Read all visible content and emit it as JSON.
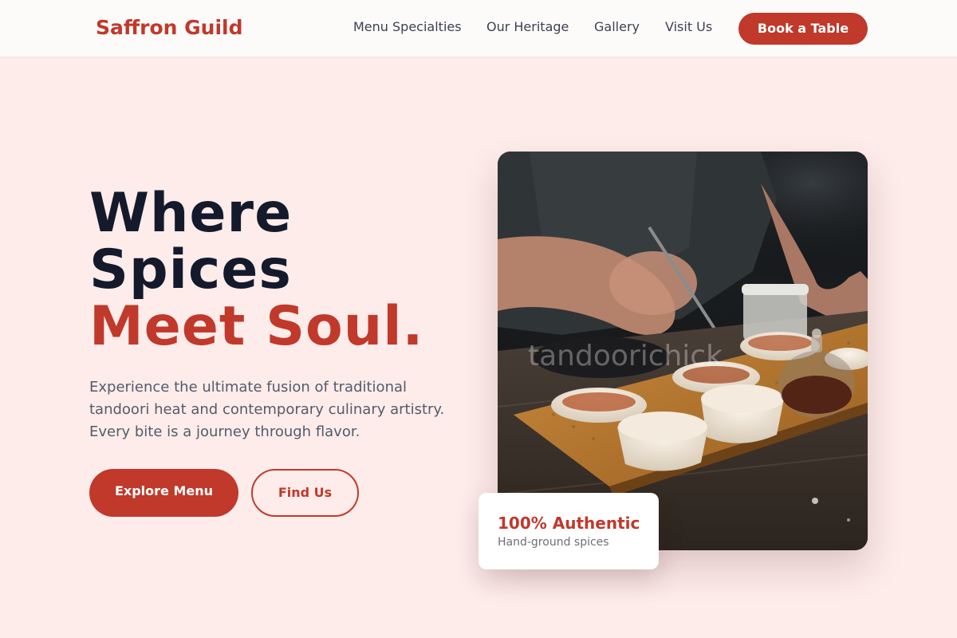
{
  "nav": {
    "brand": "Saffron Guild",
    "links": [
      "Menu Specialties",
      "Our Heritage",
      "Gallery",
      "Visit Us"
    ],
    "cta": "Book a Table"
  },
  "hero": {
    "headline_line1": "Where",
    "headline_line2": "Spices",
    "headline_accent": "Meet Soul.",
    "description": "Experience the ultimate fusion of traditional tandoori heat and contemporary culinary artistry. Every bite is a journey through flavor.",
    "primary_button": "Explore Menu",
    "secondary_button": "Find Us",
    "image_watermark": "tandoorichick"
  },
  "badge": {
    "title": "100% Authentic",
    "subtitle": "Hand-ground spices"
  },
  "colors": {
    "accent": "#c0392b",
    "background": "#fdecea",
    "heading": "#141a2c",
    "body_text": "#545b6a"
  }
}
